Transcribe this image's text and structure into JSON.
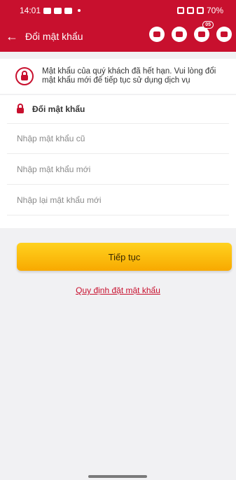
{
  "status_bar": {
    "time": "14:01",
    "battery": "70%"
  },
  "header": {
    "back_icon": "←",
    "title": "Đổi mật khẩu",
    "notification_count": "05"
  },
  "notice": {
    "text": "Mật khẩu của quý khách đã hết hạn. Vui lòng đổi mật khẩu mới để tiếp tục sử dụng dịch vụ"
  },
  "form": {
    "section_title": "Đổi mật khẩu",
    "old_password_placeholder": "Nhập mật khẩu cũ",
    "new_password_placeholder": "Nhập mật khẩu mới",
    "confirm_password_placeholder": "Nhập lại mật khẩu mới"
  },
  "actions": {
    "continue_label": "Tiếp tục",
    "rules_link": "Quy định đặt mật khẩu"
  },
  "colors": {
    "brand_red": "#c8102e",
    "button_yellow": "#fcc010"
  }
}
